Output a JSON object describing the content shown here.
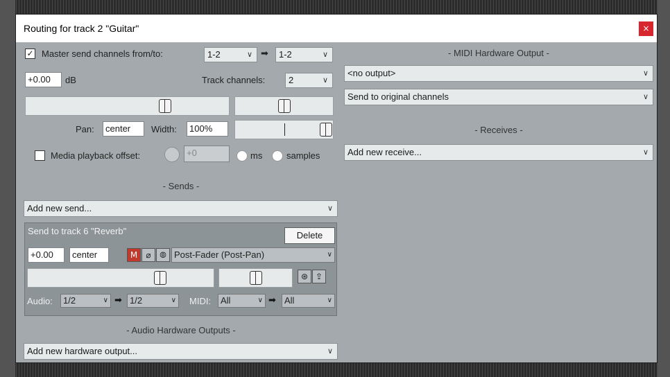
{
  "window": {
    "title": "Routing for track 2 \"Guitar\"",
    "close_glyph": "×"
  },
  "master": {
    "checkbox_checked": true,
    "label": "Master send channels from/to:",
    "from": "1-2",
    "to": "1-2",
    "arrow": "➡",
    "volume": "+0.00",
    "volume_unit": "dB",
    "track_channels_label": "Track channels:",
    "track_channels": "2",
    "pan_label": "Pan:",
    "pan": "center",
    "width_label": "Width:",
    "width": "100%"
  },
  "media_offset": {
    "checked": false,
    "label": "Media playback offset:",
    "value": "+0",
    "opt_ms": "ms",
    "opt_samples": "samples"
  },
  "sends": {
    "title": "- Sends -",
    "add_label": "Add new send...",
    "item": {
      "title": "Send to track 6 \"Reverb\"",
      "delete_label": "Delete",
      "volume": "+0.00",
      "pan": "center",
      "mute_glyph": "M",
      "phase_glyph": "⌀",
      "mono_glyph": "⦾",
      "mode": "Post-Fader (Post-Pan)",
      "audio_label": "Audio:",
      "audio_from": "1/2",
      "audio_to": "1/2",
      "midi_label": "MIDI:",
      "midi_from": "All",
      "midi_to": "All",
      "env_glyph": "⊛",
      "up_glyph": "⇪"
    }
  },
  "audio_hw": {
    "title": "- Audio Hardware Outputs -",
    "add_label": "Add new hardware output..."
  },
  "midi_hw": {
    "title": "- MIDI Hardware Output -",
    "output": "<no output>",
    "channels": "Send to original channels"
  },
  "receives": {
    "title": "- Receives -",
    "add_label": "Add new receive..."
  },
  "dropdown_arrow": "∨",
  "colors": {
    "dialog_bg": "#a3a9ac",
    "close_red": "#d8262e",
    "mute_red": "#c0392b"
  }
}
